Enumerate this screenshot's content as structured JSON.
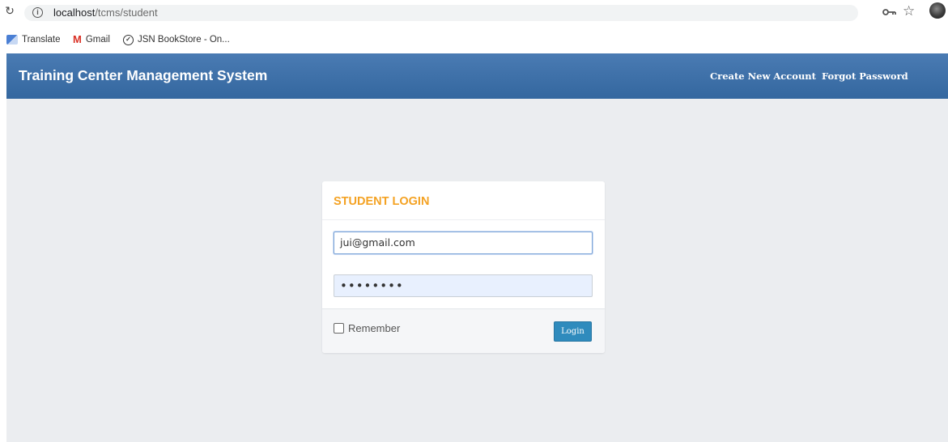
{
  "browser": {
    "url_host": "localhost",
    "url_path": "/tcms/student",
    "bookmarks": [
      {
        "label": "Translate",
        "icon": "translate-icon"
      },
      {
        "label": "Gmail",
        "icon": "gmail-icon"
      },
      {
        "label": "JSN BookStore - On...",
        "icon": "jsn-icon"
      }
    ]
  },
  "header": {
    "brand": "Training Center Management System",
    "links": [
      "Create New Account",
      "Forgot Password"
    ],
    "color": "#3a6ea8"
  },
  "login": {
    "title": "STUDENT LOGIN",
    "email_value": "jui@gmail.com",
    "password_mask": "••••••••",
    "remember_label": "Remember",
    "remember_checked": false,
    "button_label": "Login",
    "title_color": "#f4a223",
    "button_color": "#2f8bbd"
  }
}
